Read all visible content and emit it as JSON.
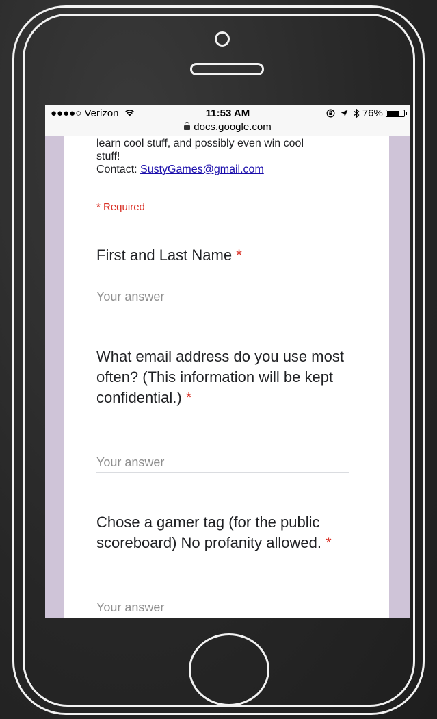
{
  "status_bar": {
    "carrier": "●●●●○ Verizon",
    "time": "11:53 AM",
    "right": "76%",
    "battery_level": 0.76
  },
  "url_bar": {
    "domain": "docs.google.com"
  },
  "form": {
    "desc_line_1": "learn cool stuff, and possibly even win cool",
    "desc_line_2": "stuff!",
    "contact_label": "Contact: ",
    "contact_email": "SustyGames@gmail.com",
    "required_note": "* Required",
    "questions": [
      {
        "text": "First and Last Name",
        "required_mark": "*",
        "placeholder": "Your answer"
      },
      {
        "text": "What email address do you use most often? (This information will be kept confidential.)",
        "required_mark": "*",
        "placeholder": "Your answer"
      },
      {
        "text": "Chose a gamer tag (for the public scoreboard) No profanity allowed.",
        "required_mark": "*",
        "placeholder": "Your answer"
      }
    ]
  }
}
